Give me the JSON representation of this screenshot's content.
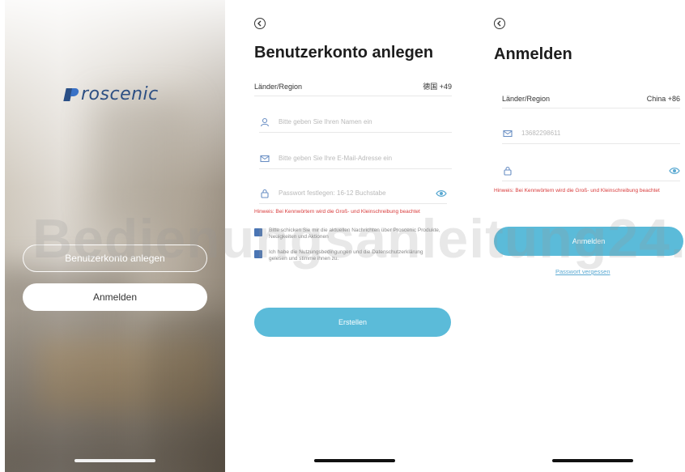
{
  "splash": {
    "logo_text": "roscenic",
    "create_account_label": "Benutzerkonto anlegen",
    "login_label": "Anmelden"
  },
  "register": {
    "title": "Benutzerkonto anlegen",
    "region_label": "Länder/Region",
    "region_value": "德国 +49",
    "name_placeholder": "Bitte geben Sie Ihren Namen ein",
    "email_placeholder": "Bitte geben Sie Ihre E-Mail-Adresse ein",
    "password_placeholder": "Passwort festlegen: 16-12 Buchstabe",
    "hint": "Hinweis: Bei Kennwörtern wird die Groß- und Kleinschreibung beachtet",
    "newsletter_text": "Bitte schicken Sie mir die aktuellen Nachrichten über Proscenic Produkte, Neuigkeiten und Aktionen",
    "privacy_text": "Ich habe die Nutzungsbedingungen und die Datenschutzerklärung gelesen und stimme ihnen zu.",
    "submit_label": "Erstellen"
  },
  "login": {
    "title": "Anmelden",
    "region_label": "Länder/Region",
    "region_value": "China +86",
    "phone_value": "13682298611",
    "hint": "Hinweis: Bei Kennwörtern wird die Groß- und Kleinschreibung beachtet",
    "submit_label": "Anmelden",
    "forgot_label": "Passwort vergessen"
  },
  "watermark": "Bedienungsanleitung24.de",
  "colors": {
    "accent": "#5bbbd9",
    "hint_red": "#d83a3a",
    "checkbox": "#4a75b4",
    "logo_blue": "#2d4f83"
  }
}
